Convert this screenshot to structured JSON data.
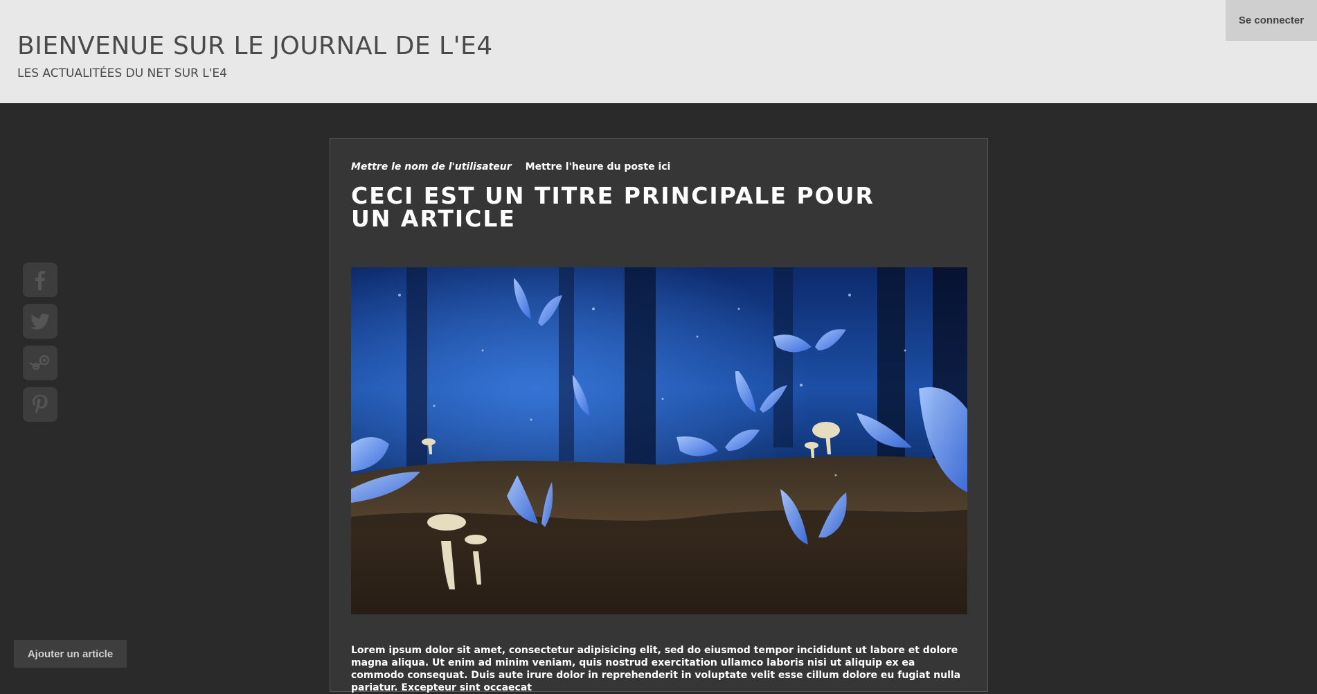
{
  "header": {
    "title": "BIENVENUE SUR LE JOURNAL DE L'E4",
    "subtitle": "LES ACTUALITÉES DU NET SUR L'E4",
    "login_label": "Se connecter"
  },
  "social": [
    {
      "name": "facebook-icon"
    },
    {
      "name": "twitter-icon"
    },
    {
      "name": "steam-icon"
    },
    {
      "name": "pinterest-icon"
    }
  ],
  "sidebar": {
    "add_article_label": "Ajouter un article"
  },
  "article": {
    "author": "Mettre le nom de l'utilisateur",
    "time": "Mettre l'heure du poste ici",
    "title": "CECI EST UN TITRE PRINCIPALE POUR UN ARTICLE",
    "image_icon": "blue-butterflies-forest-image",
    "body": "Lorem ipsum dolor sit amet, consectetur adipisicing elit, sed do eiusmod tempor incididunt ut labore et dolore magna aliqua. Ut enim ad minim veniam, quis nostrud exercitation ullamco laboris nisi ut aliquip ex ea commodo consequat. Duis aute irure dolor in reprehenderit in voluptate velit esse cillum dolore eu fugiat nulla pariatur. Excepteur sint occaecat"
  },
  "colors": {
    "header_bg": "#e8e8e8",
    "page_bg": "#2a2a2a",
    "article_bg": "#363636",
    "button_bg": "#3e3e3e"
  }
}
